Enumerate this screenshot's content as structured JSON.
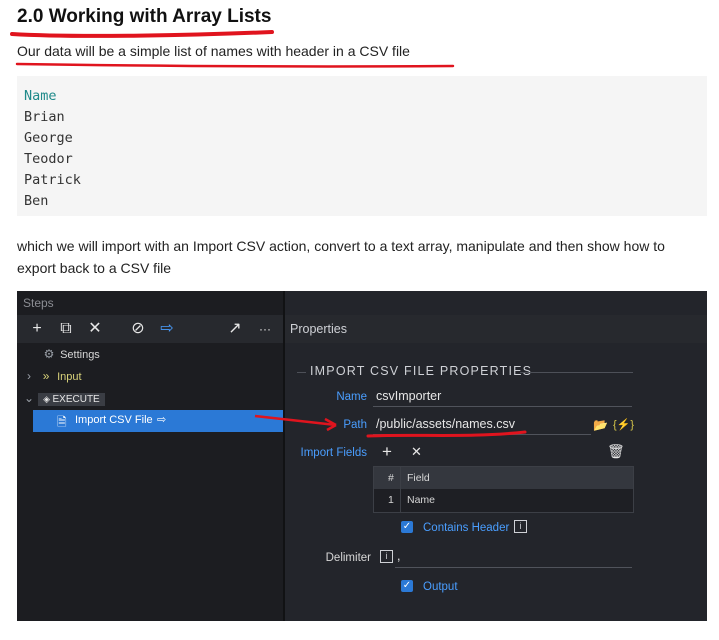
{
  "doc": {
    "heading": "2.0 Working with Array Lists",
    "subtext": "Our data will be a simple list of names with header in a CSV file",
    "code_lines": [
      "Name",
      "Brian",
      "George",
      "Teodor",
      "Patrick",
      "Ben"
    ],
    "paragraph": "which we will import with an Import CSV action, convert to a text array, manipulate and then show how to export back to a CSV file"
  },
  "app": {
    "steps_title": "Steps",
    "properties_title": "Properties",
    "toolbar_icons": [
      "plus-icon",
      "copy-icon",
      "close-icon",
      "disable-icon",
      "export-icon",
      "share-icon",
      "more-icon"
    ],
    "toolbar_glyphs": [
      "+",
      "⧉",
      "✕",
      "⊘",
      "⇨",
      "↗",
      "···"
    ],
    "tree": {
      "settings": "Settings",
      "input": "Input",
      "execute": "EXECUTE",
      "import_csv": "Import CSV File"
    },
    "props": {
      "section_title": "IMPORT CSV FILE PROPERTIES",
      "name_label": "Name",
      "name_value": "csvImporter",
      "path_label": "Path",
      "path_value": "/public/assets/names.csv",
      "import_fields_label": "Import Fields",
      "grid_col_num": "#",
      "grid_col_field": "Field",
      "grid_row_num": "1",
      "grid_row_field": "Name",
      "contains_header": "Contains Header",
      "delimiter_label": "Delimiter",
      "delimiter_value": ",",
      "output_label": "Output",
      "dynamic_glyph": "{⚡}"
    },
    "colors": {
      "accent": "#4a9eff",
      "selected": "#2b79d6",
      "annotation_red": "#e0141e"
    }
  }
}
